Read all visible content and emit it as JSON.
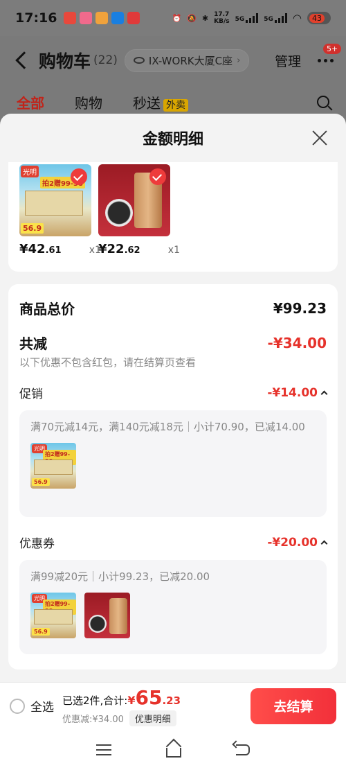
{
  "status_bar": {
    "time": "17:16",
    "network_speed": "17.7",
    "network_unit": "KB/s",
    "signal_1": "5G",
    "signal_2": "5G",
    "battery": "43"
  },
  "header": {
    "title": "购物车",
    "count": "(22)",
    "address": "IX-WORK大厦C座",
    "manage_label": "管理",
    "more_badge": "5+"
  },
  "tabs": [
    {
      "label": "全部",
      "active": true
    },
    {
      "label": "购物",
      "active": false
    },
    {
      "label": "秒送",
      "active": false,
      "tag": "外卖"
    }
  ],
  "sheet": {
    "title": "金额明细",
    "items": [
      {
        "price_int": "¥42",
        "price_dec": ".61",
        "qty": "x1",
        "image_icon": "milk-product-image",
        "thumb_text": {
          "brand": "光明",
          "banner": "拍2赠99-38",
          "price": "56.9"
        }
      },
      {
        "price_int": "¥22",
        "price_dec": ".62",
        "qty": "x1",
        "image_icon": "tea-product-image"
      }
    ],
    "total_label": "商品总价",
    "total_value": "¥99.23",
    "discount_label": "共减",
    "discount_value": "-¥34.00",
    "discount_note": "以下优惠不包含红包，请在结算页查看",
    "promo": {
      "label": "促销",
      "value": "-¥14.00",
      "desc": "满70元减14元，满140元减18元｜小计70.90，已减14.00"
    },
    "coupon": {
      "label": "优惠券",
      "value": "-¥20.00",
      "desc": "满99减20元｜小计99.23，已减20.00"
    }
  },
  "bottom_bar": {
    "select_all": "全选",
    "selected_text": "已选2件,合计:",
    "currency": "¥",
    "total_int": "65",
    "total_dec": ".23",
    "saved_text": "优惠减:¥34.00",
    "detail_button": "优惠明细",
    "checkout_button": "去结算"
  },
  "colors": {
    "accent_red": "#e6322b",
    "checkout_red": "#ff4d4a"
  }
}
